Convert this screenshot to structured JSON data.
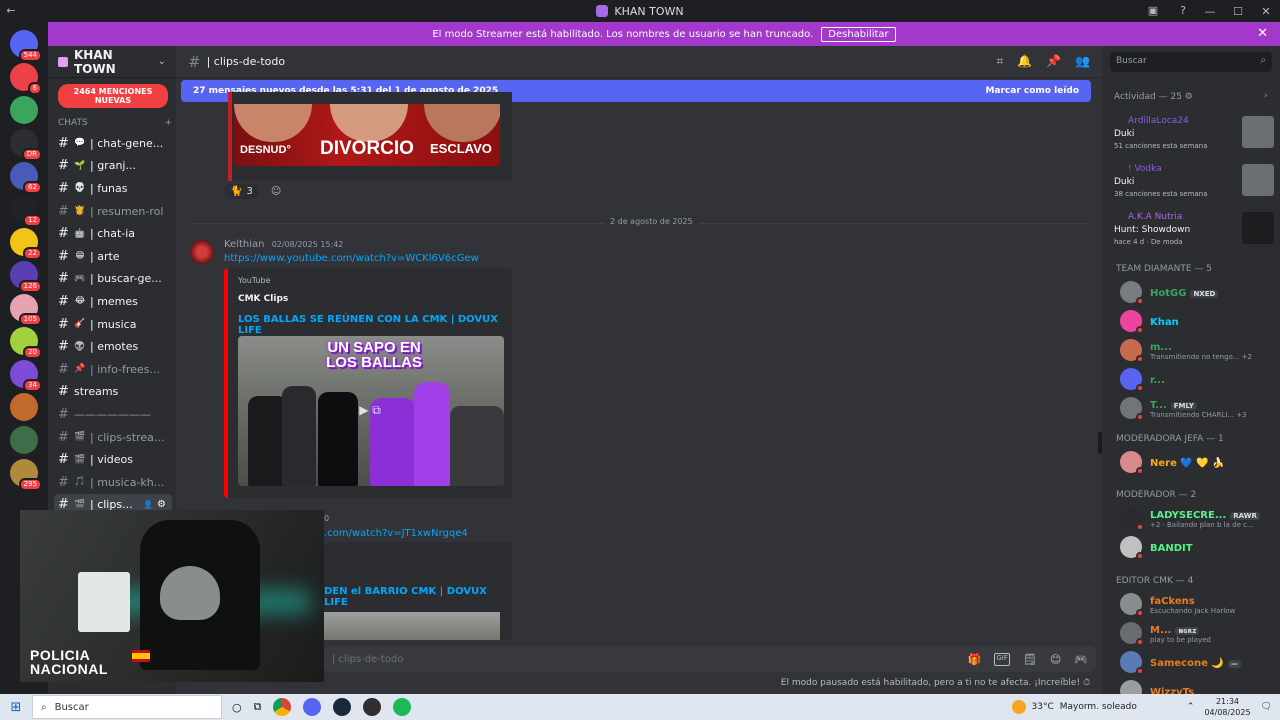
{
  "window": {
    "title": "KHAN TOWN",
    "controls": [
      "—",
      "☐",
      "✕"
    ]
  },
  "banner": {
    "text": "El modo Streamer está habilitado. Los nombres de usuario se han truncado.",
    "button": "Deshabilitar",
    "close": "✕"
  },
  "servers": [
    {
      "badge": "544"
    },
    {
      "badge": "6"
    },
    {
      "badge": ""
    },
    {
      "badge": "DR"
    },
    {
      "badge": "62"
    },
    {
      "badge": "12"
    },
    {
      "badge": "22"
    },
    {
      "badge": "126"
    },
    {
      "badge": "105"
    },
    {
      "badge": "20"
    },
    {
      "badge": "34"
    },
    {
      "badge": ""
    },
    {
      "badge": ""
    },
    {
      "badge": "295"
    }
  ],
  "guild": {
    "name": "KHAN TOWN",
    "mentions": "2464 MENCIONES NUEVAS",
    "category": "CHATS"
  },
  "channels": [
    {
      "emoji": "💬",
      "label": "| chat-gene...",
      "bright": true
    },
    {
      "emoji": "🌱",
      "label": "| granj...",
      "bright": true
    },
    {
      "emoji": "💀",
      "label": "| funas",
      "bright": true
    },
    {
      "emoji": "👸",
      "label": "| resumen-rol",
      "bright": false
    },
    {
      "emoji": "🤖",
      "label": "| chat-ia",
      "bright": true
    },
    {
      "emoji": "😁",
      "label": "| arte",
      "bright": true
    },
    {
      "emoji": "🎮",
      "label": "| buscar-ge...",
      "bright": true
    },
    {
      "emoji": "😂",
      "label": "| memes",
      "bright": true
    },
    {
      "emoji": "🎸",
      "label": "| musica",
      "bright": true
    },
    {
      "emoji": "👽",
      "label": "| emotes",
      "bright": true
    },
    {
      "emoji": "📌",
      "label": "| info-frees...",
      "bright": false
    },
    {
      "emoji": "",
      "label": "streams",
      "bright": true
    },
    {
      "emoji": "",
      "label": "———————",
      "bright": false
    },
    {
      "emoji": "🎬",
      "label": "| clips-strea...",
      "bright": false
    },
    {
      "emoji": "🎬",
      "label": "| videos",
      "bright": true
    },
    {
      "emoji": "🎵",
      "label": "| musica-kh...",
      "bright": false
    },
    {
      "emoji": "🎬",
      "label": "| clips...",
      "bright": true,
      "active": true
    }
  ],
  "header": {
    "channel": "| clips-de-todo"
  },
  "newbar": {
    "text": "27 mensajes nuevos desde las 5:31 del 1 de agosto de 2025",
    "action": "Marcar como leído"
  },
  "top_image": {
    "words": [
      "DESNUD°",
      "DIVORCIO",
      "ESCLAVO"
    ]
  },
  "reactions": [
    {
      "emoji": "🐈",
      "count": "3"
    }
  ],
  "date_divider": "2 de agosto de 2025",
  "message1": {
    "author": "Kelthian",
    "time": "02/08/2025 15:42",
    "link": "https://www.youtube.com/watch?v=WCKl6V6cGew",
    "embed": {
      "provider": "YouTube",
      "author": "CMK Clips",
      "title": "LOS BALLAS SE REÚNEN CON LA CMK | DOVUX LIFE",
      "overlay": "UN SAPO EN LOS BALLAS"
    }
  },
  "message2": {
    "time_fragment": "0",
    "link": ".com/watch?v=JT1xwNrgqe4",
    "embed_title": "DEN el BARRIO CMK | DOVUX LIFE"
  },
  "composer": {
    "placeholder": "| clips-de-todo",
    "icons": [
      "🎁",
      "GIF",
      "🗒",
      "😊",
      "🎮"
    ]
  },
  "footer_note": "El modo pausado está habilitado, pero a ti no te afecta. ¡Increíble!",
  "members": {
    "search_placeholder": "Buscar",
    "activity_header": "Actividad — 25",
    "activities": [
      {
        "user": "ArdillaLoca24",
        "song": "Duki",
        "sub": "51 canciones esta semana",
        "color": "#8d5ae0"
      },
      {
        "user": "! Vodka",
        "song": "Duki",
        "sub": "38 canciones esta semana",
        "color": "#8d5ae0"
      },
      {
        "user": "A.K.A Nutria",
        "song": "Hunt: Showdown",
        "sub": "hace 4 d · De moda",
        "color": "#a46be8"
      }
    ],
    "sections": [
      {
        "title": "TEAM DIAMANTE — 5",
        "items": [
          {
            "name": "HotGG",
            "tag": "NXED",
            "sub": "",
            "color": "#3ba55c"
          },
          {
            "name": "Khan",
            "tag": "",
            "sub": "",
            "color": "#00d1ff"
          },
          {
            "name": "m...",
            "tag": "",
            "sub": "Transmitiendo no tengo... +2",
            "color": "#3ba55c"
          },
          {
            "name": "r...",
            "tag": "",
            "sub": "",
            "color": "#3ba55c"
          },
          {
            "name": "T...",
            "tag": "FMLY",
            "sub": "Transmitiendo CHARLI... +3",
            "color": "#3ba55c"
          }
        ]
      },
      {
        "title": "MODERADORA JEFA — 1",
        "items": [
          {
            "name": "Nere 💙 💛 🍌",
            "tag": "",
            "sub": "",
            "color": "#faa61a"
          }
        ]
      },
      {
        "title": "MODERADOR — 2",
        "items": [
          {
            "name": "LADYSECRE...",
            "tag": "RAWR",
            "sub": "+2 · Bailando plan b la de c...",
            "color": "#57f287"
          },
          {
            "name": "BANDIT",
            "tag": "",
            "sub": "",
            "color": "#57f287"
          }
        ]
      },
      {
        "title": "EDITOR CMK — 4",
        "items": [
          {
            "name": "faCkens",
            "tag": "",
            "sub": "Escuchando Jack Harlow",
            "color": "#e67e22"
          },
          {
            "name": "M...",
            "tag": "ɴɢʀᴢ",
            "sub": "play to be played",
            "color": "#e67e22"
          },
          {
            "name": "Samecone 🌙",
            "tag": "—",
            "sub": "",
            "color": "#e67e22"
          },
          {
            "name": "WizzyTs",
            "tag": "",
            "sub": "",
            "color": "#e67e22"
          }
        ]
      }
    ]
  },
  "webcam": {
    "logo_line1": "POLICIA",
    "logo_line2": "NACIONAL"
  },
  "taskbar": {
    "search": "Buscar",
    "weather_temp": "33°C",
    "weather_text": "Mayorm. soleado",
    "time": "21:34",
    "date": "04/08/2025"
  }
}
